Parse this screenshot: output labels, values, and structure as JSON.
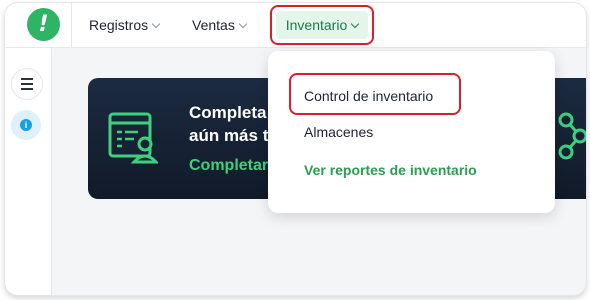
{
  "nav": {
    "items": [
      {
        "label": "Registros"
      },
      {
        "label": "Ventas"
      },
      {
        "label": "Inventario"
      }
    ]
  },
  "dropdown": {
    "items": [
      {
        "label": "Control de inventario"
      },
      {
        "label": "Almacenes"
      },
      {
        "label": "Ver reportes de inventario"
      }
    ]
  },
  "banner": {
    "title_line1": "Completa",
    "title_line2": "aún más tu",
    "link_label": "Completar"
  },
  "sidebar": {
    "menu_icon": "hamburger-icon",
    "info_icon": "info-icon",
    "info_glyph": "i"
  },
  "logo": {
    "glyph": "!"
  },
  "colors": {
    "brand_green": "#2fb364",
    "highlight_red": "#d9202a",
    "banner_dark": "#152235",
    "link_green": "#3ed07d"
  }
}
